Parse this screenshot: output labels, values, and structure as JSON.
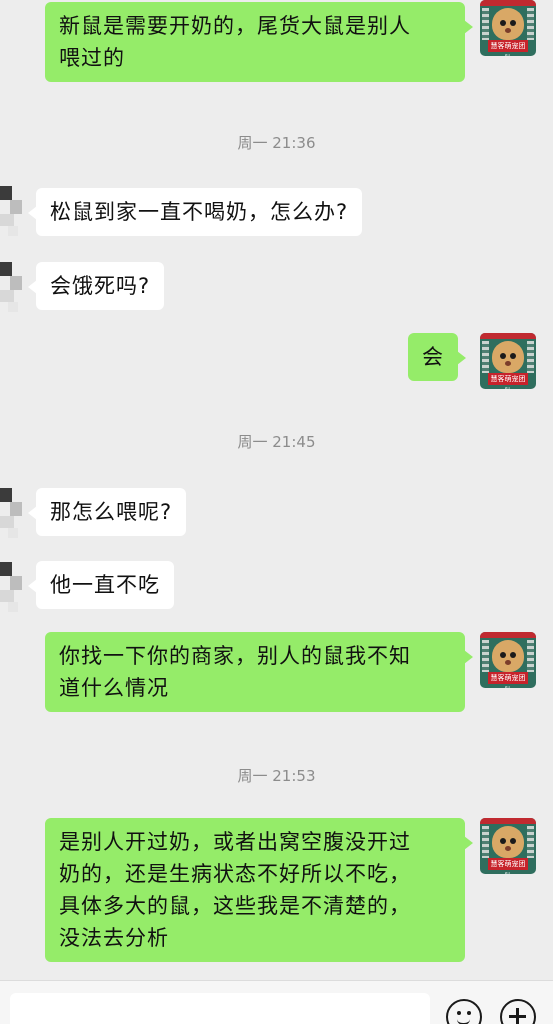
{
  "messages": [
    {
      "side": "out",
      "text": "新鼠是需要开奶的，尾货大鼠是别人\n喂过的"
    },
    {
      "timestamp": "周一 21:36"
    },
    {
      "side": "in",
      "text": "松鼠到家一直不喝奶，怎么办?"
    },
    {
      "side": "in",
      "text": "会饿死吗?"
    },
    {
      "side": "out",
      "text": "会"
    },
    {
      "timestamp": "周一 21:45"
    },
    {
      "side": "in",
      "text": "那怎么喂呢?"
    },
    {
      "side": "in",
      "text": "他一直不吃"
    },
    {
      "side": "out",
      "text": "你找一下你的商家，别人的鼠我不知\n道什么情况"
    },
    {
      "timestamp": "周一 21:53"
    },
    {
      "side": "out",
      "text": "是别人开过奶，或者出窝空腹没开过\n奶的，还是生病状态不好所以不吃，\n具体多大的鼠，这些我是不清楚的，\n没法去分析"
    }
  ],
  "self_avatar": {
    "banner_text": "慧客萌宠团队",
    "icon": "hamster-avatar"
  },
  "input_bar": {
    "value": "",
    "emoji_icon": "emoji-icon",
    "add_icon": "plus-circle-icon"
  },
  "colors": {
    "outgoing_bubble": "#95ec69",
    "incoming_bubble": "#ffffff",
    "background": "#ededed"
  }
}
